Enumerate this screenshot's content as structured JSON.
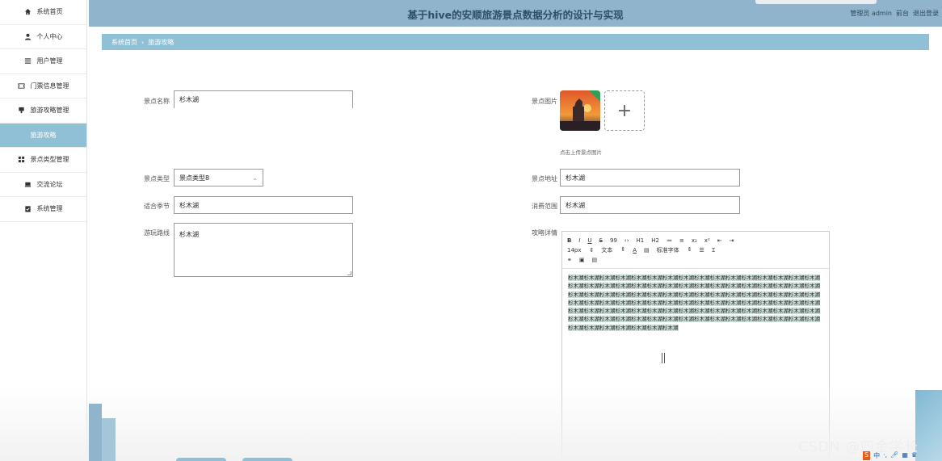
{
  "sidebar": {
    "items": [
      {
        "label": "系统首页",
        "icon": "home-icon"
      },
      {
        "label": "个人中心",
        "icon": "user-icon"
      },
      {
        "label": "用户管理",
        "icon": "list-icon"
      },
      {
        "label": "门票信息管理",
        "icon": "ticket-icon"
      },
      {
        "label": "旅游攻略管理",
        "icon": "book-icon"
      },
      {
        "label": "旅游攻略",
        "icon": ""
      },
      {
        "label": "景点类型管理",
        "icon": "grid-icon"
      },
      {
        "label": "交流论坛",
        "icon": "forum-icon"
      },
      {
        "label": "系统管理",
        "icon": "clipboard-icon"
      }
    ]
  },
  "header": {
    "title": "基于hive的安顺旅游景点数据分析的设计与实现",
    "role": "管理员 admin",
    "frontend": "前台",
    "logout": "退出登录"
  },
  "breadcrumb": {
    "home": "系统首页",
    "sep": "›",
    "current": "旅游攻略"
  },
  "form": {
    "name_label": "景点名称",
    "name_value": "杉木湖",
    "image_label": "景点图片",
    "upload_tip": "点击上传景点图片",
    "type_label": "景点类型",
    "type_value": "景点类型8",
    "location_label": "景点地址",
    "location_value": "杉木湖",
    "season_label": "适合季节",
    "season_value": "杉木湖",
    "range_label": "消费范围",
    "range_value": "杉木湖",
    "route_label": "游玩路线",
    "route_value": "杉木湖",
    "detail_label": "攻略详情"
  },
  "editor": {
    "toolbar1": [
      "B",
      "I",
      "U",
      "S",
      "99",
      "‹›",
      "H1",
      "H2",
      "≔",
      "≡",
      "x₂",
      "x²",
      "⇤",
      "⇥"
    ],
    "font_size": "14px",
    "text_type": "文本",
    "font_color": "A",
    "font_family": "标准字体",
    "content": "杉木湖杉木湖杉木湖杉木湖杉木湖杉木湖杉木湖杉木湖杉木湖杉木湖杉木湖杉木湖杉木湖杉木湖杉木湖杉木湖杉木湖杉木湖杉木湖杉木湖杉木湖杉木湖杉木湖杉木湖杉木湖杉木湖杉木湖杉木湖杉木湖杉木湖杉木湖杉木湖杉木湖杉木湖杉木湖杉木湖杉木湖杉木湖杉木湖杉木湖杉木湖杉木湖杉木湖杉木湖杉木湖杉木湖杉木湖杉木湖杉木湖杉木湖杉木湖杉木湖杉木湖杉木湖杉木湖杉木湖杉木湖杉木湖杉木湖杉木湖杉木湖杉木湖杉木湖杉木湖杉木湖杉木湖杉木湖杉木湖杉木湖杉木湖杉木湖杉木湖杉木湖杉木湖杉木湖杉木湖杉木湖杉木湖杉木湖杉木湖杉木湖杉木湖杉木湖杉木湖杉木湖杉木湖杉木湖杉木湖杉木湖杉木湖杉木湖杉木湖杉木湖杉木湖杉木湖杉木湖杉木湖杉木湖杉木湖杉木湖杉木湖杉木湖杉木湖"
  },
  "watermark": "CSDN @四金学长",
  "colors": {
    "accent": "#8fc0d6",
    "header": "#8fb4cb"
  }
}
